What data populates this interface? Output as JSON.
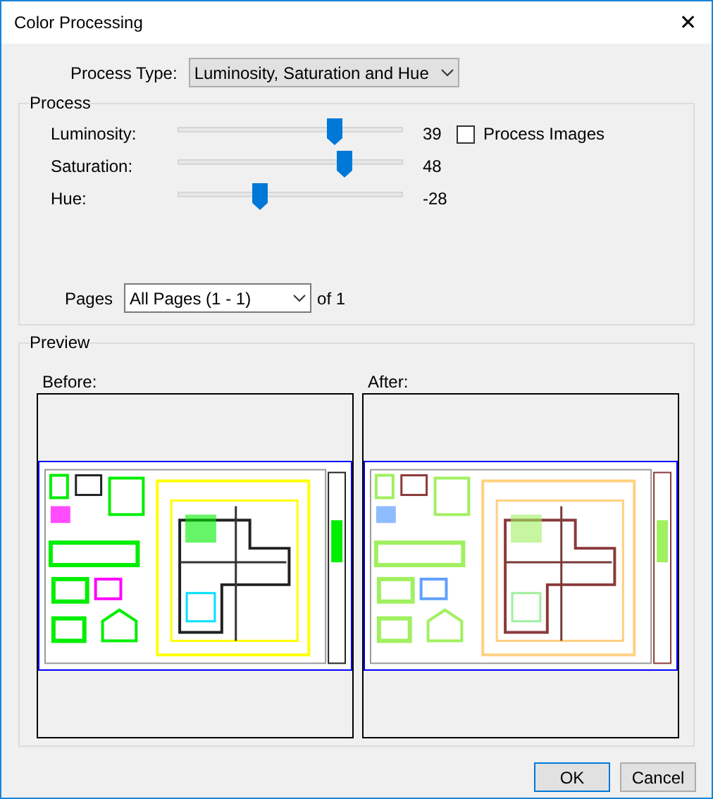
{
  "window": {
    "title": "Color Processing",
    "close": "✕"
  },
  "process_type": {
    "label": "Process Type:",
    "value": "Luminosity, Saturation and Hue"
  },
  "process": {
    "title": "Process",
    "sliders": [
      {
        "label": "Luminosity:",
        "level": 0.695,
        "reading": "39"
      },
      {
        "label": "Saturation:",
        "level": 0.74,
        "reading": "48"
      },
      {
        "label": "Hue:",
        "level": 0.36,
        "reading": "-28"
      }
    ],
    "process_images": {
      "label": "Process Images",
      "checked": false
    },
    "pages": {
      "label": "Pages",
      "value": "All Pages (1 - 1)",
      "suffix": "of 1"
    }
  },
  "preview": {
    "title": "Preview",
    "panels": [
      {
        "label": "Before:",
        "kind": "original"
      },
      {
        "label": "After:",
        "kind": "processed"
      }
    ]
  },
  "buttons": [
    "OK",
    "Cancel"
  ]
}
